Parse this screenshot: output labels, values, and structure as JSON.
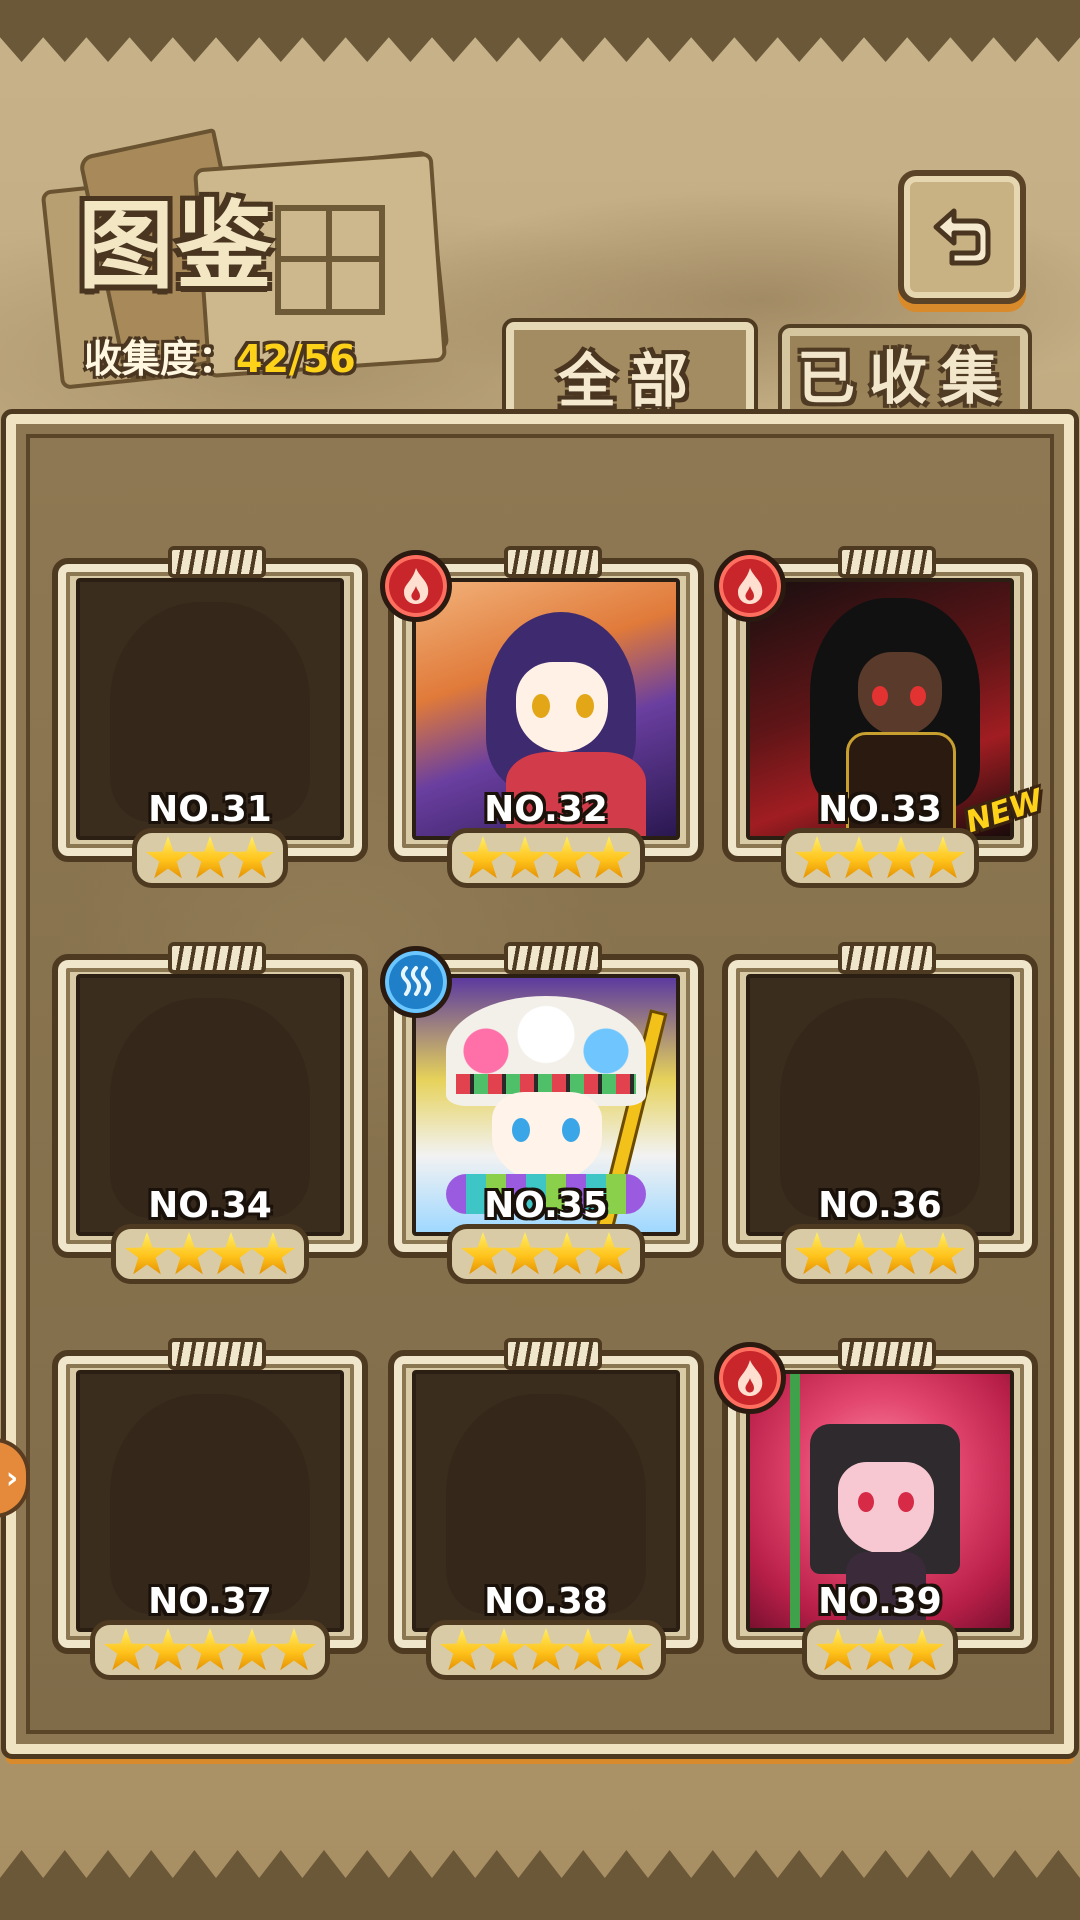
{
  "header": {
    "title": "图鉴",
    "collection_label": "收集度：",
    "collection_value": "42/56"
  },
  "tabs": [
    {
      "label": "全部",
      "active": true
    },
    {
      "label": "已收集",
      "active": false
    }
  ],
  "cards": [
    {
      "number": "NO.31",
      "stars": 3,
      "collected": false,
      "element": null,
      "new": false
    },
    {
      "number": "NO.32",
      "stars": 4,
      "collected": true,
      "element": "fire",
      "new": false
    },
    {
      "number": "NO.33",
      "stars": 4,
      "collected": true,
      "element": "fire",
      "new": true,
      "new_label": "NEW"
    },
    {
      "number": "NO.34",
      "stars": 4,
      "collected": false,
      "element": null,
      "new": false
    },
    {
      "number": "NO.35",
      "stars": 4,
      "collected": true,
      "element": "water",
      "new": false
    },
    {
      "number": "NO.36",
      "stars": 4,
      "collected": false,
      "element": null,
      "new": false
    },
    {
      "number": "NO.37",
      "stars": 5,
      "collected": false,
      "element": null,
      "new": false
    },
    {
      "number": "NO.38",
      "stars": 5,
      "collected": false,
      "element": null,
      "new": false
    },
    {
      "number": "NO.39",
      "stars": 3,
      "collected": true,
      "element": "fire",
      "new": false
    }
  ],
  "icons": {
    "back": "back-arrow-icon",
    "fire": "fire-element-icon",
    "water": "water-element-icon",
    "star": "star-icon",
    "side": "side-arrow-icon"
  },
  "colors": {
    "accent_orange": "#d98a2a",
    "collection_value": "#ffd21a",
    "fire": "#c8262a",
    "water": "#1f7fc8",
    "star": "#ffc21a"
  }
}
